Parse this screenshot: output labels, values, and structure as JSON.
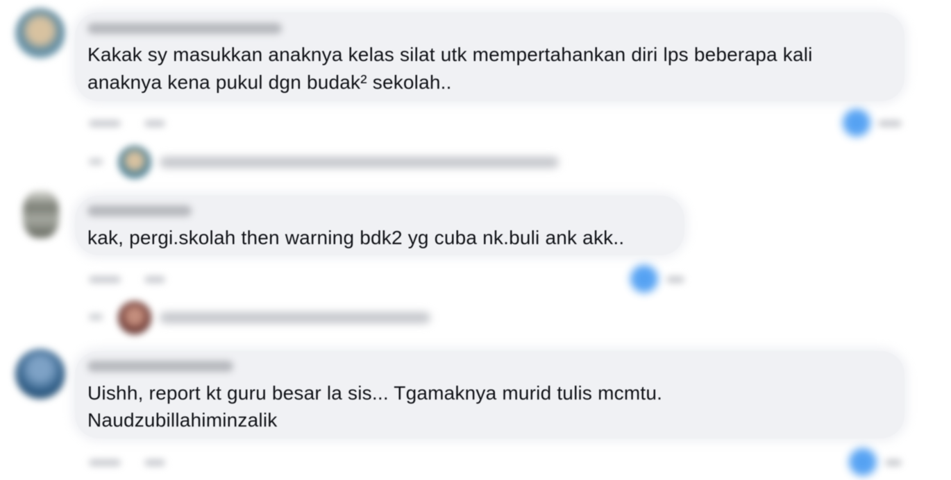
{
  "comments": [
    {
      "text": "Kakak sy masukkan anaknya kelas silat utk mempertahankan diri lps beberapa kali\nanaknya kena pukul dgn budak² sekolah..",
      "line1": "Kakak sy masukkan anaknya kelas silat utk mempertahankan diri lps beberapa kali",
      "line2": "anaknya kena pukul dgn budak² sekolah..",
      "avatar_color": "#5f8aa0",
      "has_replies": true,
      "reply_avatar_color": "#4f7f92"
    },
    {
      "text": "kak, pergi.skolah then warning bdk2 yg cuba nk.buli ank akk..",
      "line1": "kak, pergi.skolah then warning bdk2 yg cuba nk.buli ank akk..",
      "avatar_color": "#8c8f86",
      "has_replies": true,
      "reply_avatar_color": "#6f3b36"
    },
    {
      "text": "Uishh, report kt guru besar la sis... Tgamaknya murid tulis mcmtu.\nNaudzubillahiminzalik",
      "line1": "Uishh, report kt guru besar la sis... Tgamaknya murid tulis mcmtu.",
      "line2": "Naudzubillahiminzalik",
      "avatar_color": "#2f5d86",
      "has_replies": false
    }
  ],
  "colors": {
    "bubble": "#f0f1f4",
    "reaction": "#2d8cf0",
    "text": "#111318"
  },
  "icons": {
    "reaction": "like-reaction-icon",
    "reply": "reply-arrow-icon"
  }
}
